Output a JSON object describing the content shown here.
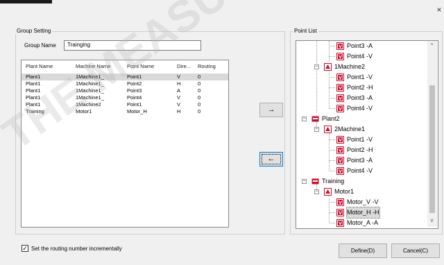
{
  "window": {
    "close_glyph": "×"
  },
  "group_setting": {
    "caption": "Group Setting",
    "group_name_label": "Group Name",
    "group_name_value": "Trainging"
  },
  "table": {
    "columns": [
      "Plant Name",
      "Machine Name",
      "Point Name",
      "Dire...",
      "Routing"
    ],
    "rows": [
      [
        "Plant1",
        "1Machine1_",
        "Point1",
        "V",
        "0"
      ],
      [
        "Plant1",
        "1Machine1_",
        "Point2",
        "H",
        "0"
      ],
      [
        "Plant1",
        "1Machine1_",
        "Point3",
        "A",
        "0"
      ],
      [
        "Plant1",
        "1Machine1_",
        "Point4",
        "V",
        "0"
      ],
      [
        "Plant1",
        "1Machine2",
        "Point1",
        "V",
        "0"
      ],
      [
        "Training",
        "Motor1",
        "Motor_H",
        "H",
        "0"
      ]
    ],
    "selected_row": 0
  },
  "buttons": {
    "add_arrow": "→",
    "remove_arrow": "←",
    "define": "Define(D)",
    "cancel": "Cancel(C)"
  },
  "point_list": {
    "caption": "Point List",
    "items": [
      {
        "label": "Point3 -A"
      },
      {
        "label": "Point4 -V"
      },
      {
        "label": "1Machine2"
      },
      {
        "label": "Point1 -V"
      },
      {
        "label": "Point2 -H"
      },
      {
        "label": "Point3 -A"
      },
      {
        "label": "Point4 -V"
      },
      {
        "label": "Plant2"
      },
      {
        "label": "2Machine1"
      },
      {
        "label": "Point1 -V"
      },
      {
        "label": "Point2 -H"
      },
      {
        "label": "Point3 -A"
      },
      {
        "label": "Point4 -V"
      },
      {
        "label": "Training"
      },
      {
        "label": "Motor1"
      },
      {
        "label": "Motor_V -V"
      },
      {
        "label": "Motor_H -H"
      },
      {
        "label": "Motor_A -A"
      }
    ],
    "scroll_up": "^",
    "scroll_down": "v"
  },
  "options": {
    "incremental_routing_label": "Set the routing number incrementally",
    "incremental_routing_checked": true,
    "check_glyph": "✓"
  },
  "watermark": {
    "text": "THE MEASUREMENT"
  },
  "colors": {
    "accent": "#0078d7",
    "tree_icon": "#c8102e"
  }
}
